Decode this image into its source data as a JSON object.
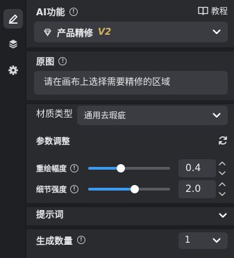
{
  "colors": {
    "accent": "#3a9bf0",
    "panel_bg": "#2a2b2f",
    "field_bg": "#3b3c41",
    "v2_badge": "#d6b25e"
  },
  "rail": [
    {
      "icon": "pencil-icon",
      "active": true
    },
    {
      "icon": "layers-icon",
      "active": false
    },
    {
      "icon": "gear-icon",
      "active": false
    }
  ],
  "ai_section": {
    "title": "AI功能",
    "tutorial_label": "教程",
    "tutorial_icon": "book-icon",
    "selected_function": "产品精修",
    "selected_function_badge": "V2",
    "function_icon": "gem-icon"
  },
  "original_section": {
    "title": "原图",
    "hint": "请在画布上选择需要精修的区域"
  },
  "material": {
    "label": "材质类型",
    "value": "通用去瑕疵"
  },
  "params": {
    "title": "参数调整",
    "reset_icon": "refresh-icon",
    "sliders": [
      {
        "label": "重绘幅度",
        "value": "0.4",
        "fraction": 0.4
      },
      {
        "label": "细节强度",
        "value": "2.0",
        "fraction": 0.57
      }
    ]
  },
  "prompt_section": {
    "title": "提示词"
  },
  "quantity": {
    "label": "生成数量",
    "value": "1"
  }
}
